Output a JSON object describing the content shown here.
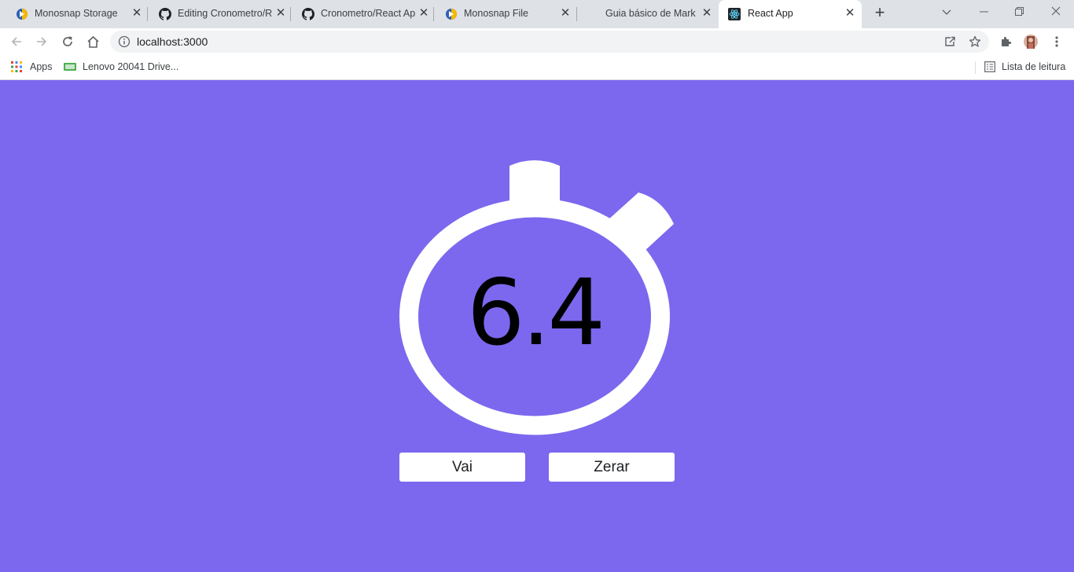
{
  "browser": {
    "tabs": [
      {
        "title": "Monosnap Storage",
        "icon": "monosnap-icon",
        "active": false
      },
      {
        "title": "Editing Cronometro/R",
        "icon": "github-icon",
        "active": false
      },
      {
        "title": "Cronometro/React Ap",
        "icon": "github-icon",
        "active": false
      },
      {
        "title": "Monosnap File",
        "icon": "monosnap-icon",
        "active": false
      },
      {
        "title": "Guia básico de Markd",
        "icon": "",
        "active": false
      },
      {
        "title": "React App",
        "icon": "react-icon",
        "active": true
      }
    ],
    "address": "localhost:3000",
    "bookmarks": [
      {
        "label": "Apps",
        "icon": "apps-grid-icon"
      },
      {
        "label": "Lenovo 20041 Drive...",
        "icon": "lenovo-icon"
      }
    ],
    "reading_list": "Lista de leitura"
  },
  "app": {
    "timer": "6.4",
    "buttons": {
      "start": "Vai",
      "reset": "Zerar"
    }
  },
  "colors": {
    "background": "#7b68ee",
    "stopwatch": "#ffffff",
    "text": "#000000"
  }
}
